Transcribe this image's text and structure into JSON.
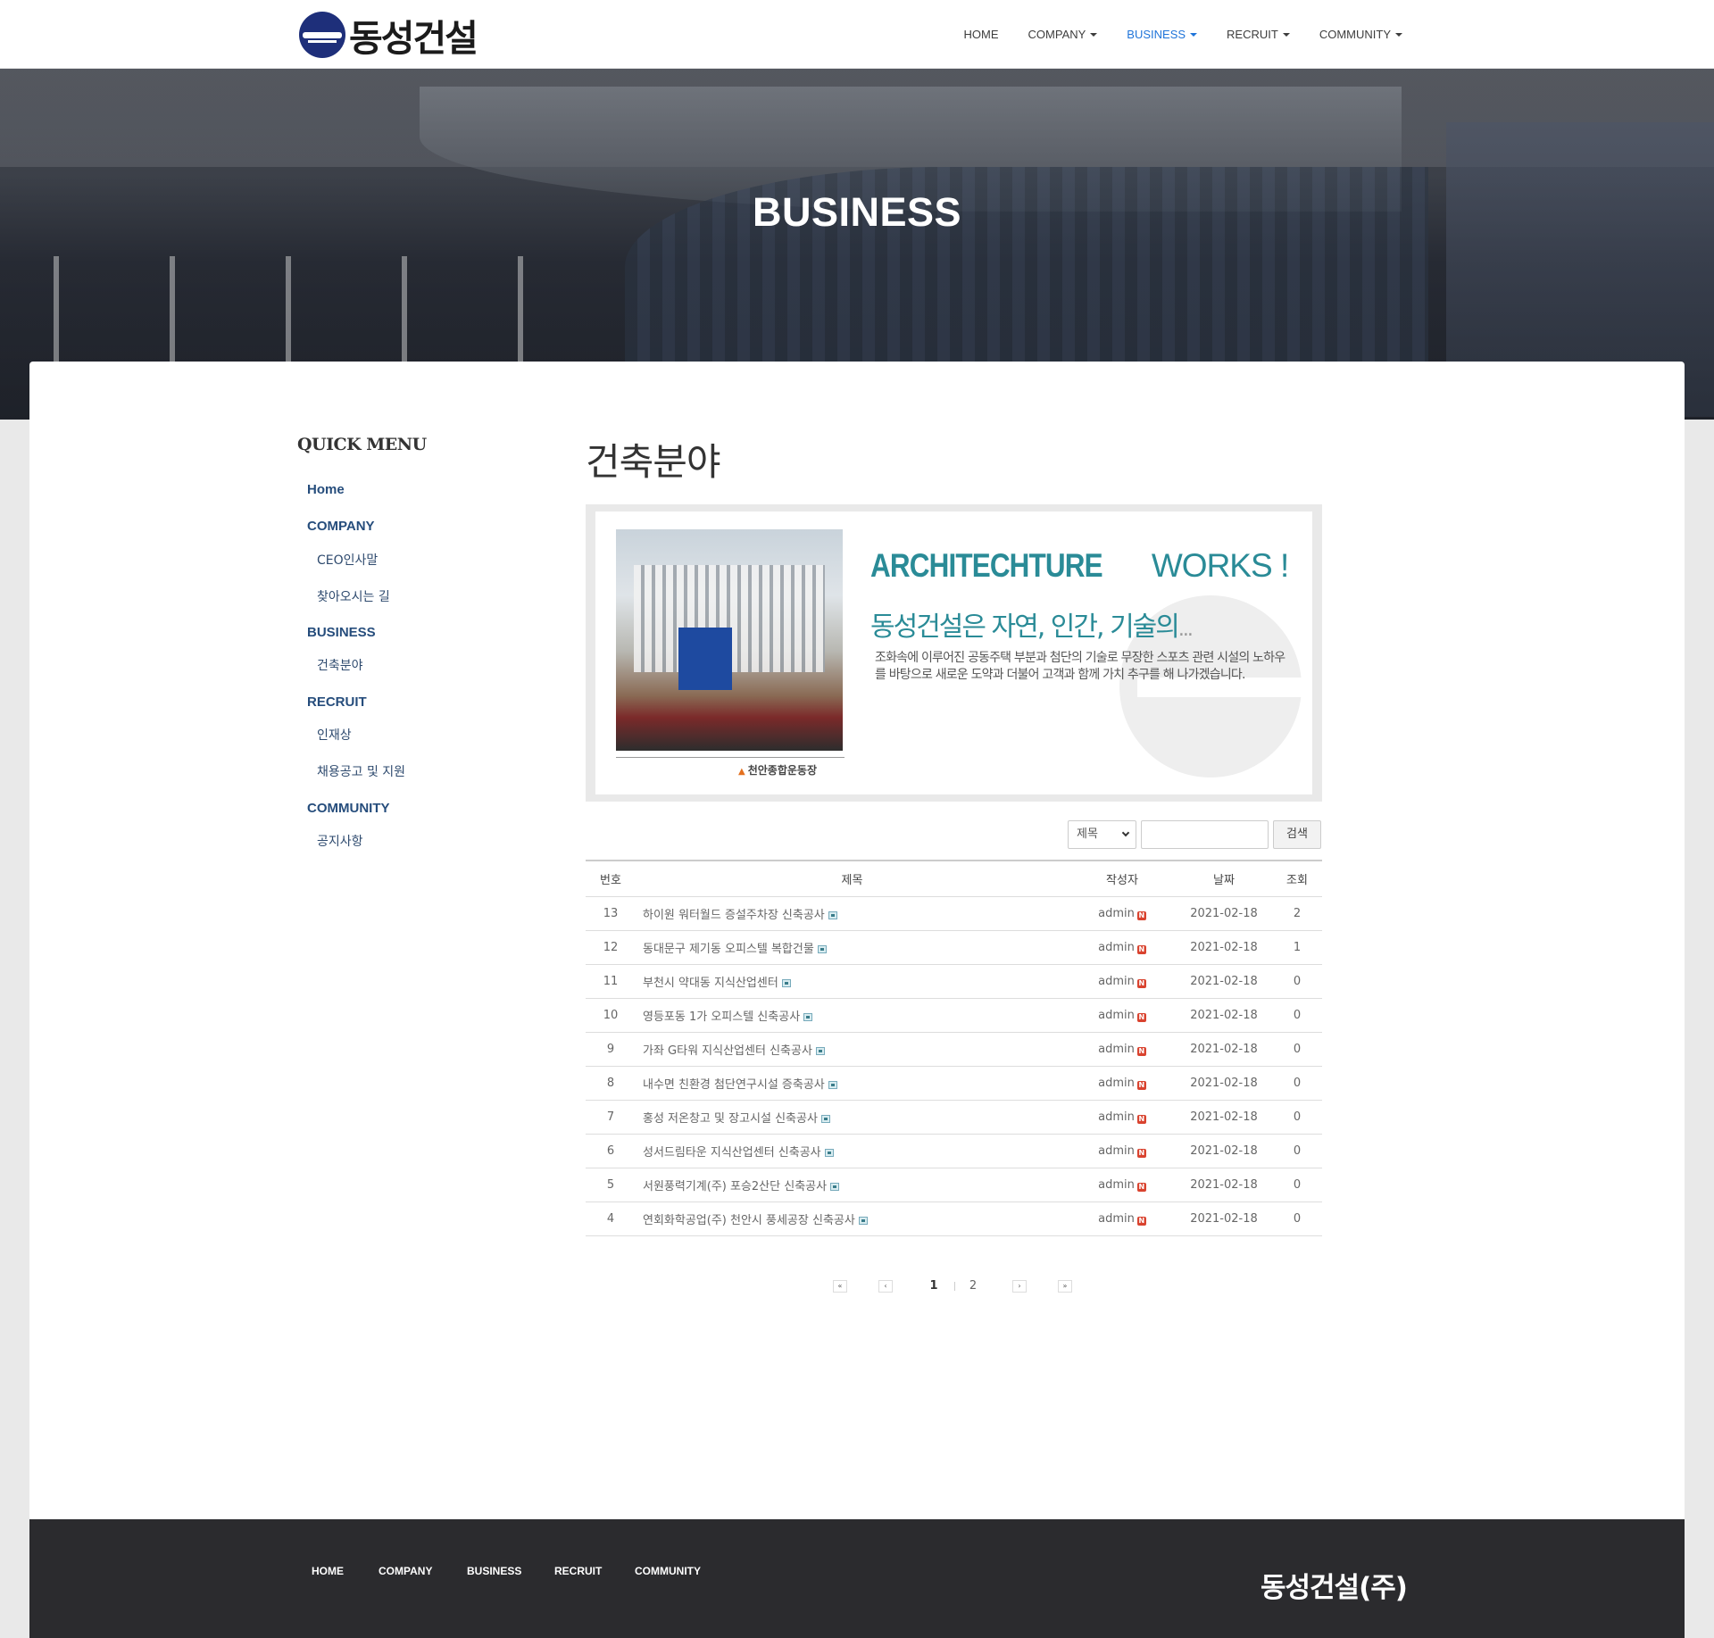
{
  "header": {
    "logo_text": "동성건설",
    "nav": [
      {
        "label": "HOME"
      },
      {
        "label": "COMPANY"
      },
      {
        "label": "BUSINESS"
      },
      {
        "label": "RECRUIT"
      },
      {
        "label": "COMMUNITY"
      }
    ],
    "active": "BUSINESS",
    "accent_color": "#1f74d9"
  },
  "hero": {
    "title": "BUSINESS"
  },
  "quick_menu": {
    "title": "QUICK MENU",
    "home": "Home",
    "company": "COMPANY",
    "company_items": [
      "CEO인사말",
      "찾아오시는 길"
    ],
    "business": "BUSINESS",
    "business_items": [
      "건축분야"
    ],
    "recruit": "RECRUIT",
    "recruit_items": [
      "인재상",
      "채용공고 및 지원"
    ],
    "community": "COMMUNITY",
    "community_items": [
      "공지사항"
    ]
  },
  "main": {
    "title": "건축분야",
    "banner": {
      "headline_a": "ARCHITECHTURE",
      "headline_b": " WORKS !",
      "subhead": "동성건설은 자연, 인간, 기술의",
      "subhead_dots": "...",
      "body": "조화속에 이루어진 공동주택 부분과 첨단의 기술로 무장한 스포츠 관련 시설의  노하우를 바탕으로 새로운 도약과 더불어 고객과 함께 가치 추구를 해 나가겠습니다.",
      "caption": "천안종합운동장"
    },
    "search": {
      "select_value": "제목",
      "input_value": "",
      "button_label": "검색"
    },
    "table": {
      "headers": [
        "번호",
        "제목",
        "작성자",
        "날짜",
        "조회"
      ],
      "rows": [
        {
          "no": "13",
          "title": "하이원 워터월드 증설주차장 신축공사",
          "author": "admin",
          "date": "2021-02-18",
          "views": "2"
        },
        {
          "no": "12",
          "title": "동대문구 제기동 오피스텔 복합건물",
          "author": "admin",
          "date": "2021-02-18",
          "views": "1"
        },
        {
          "no": "11",
          "title": "부천시 약대동 지식산업센터",
          "author": "admin",
          "date": "2021-02-18",
          "views": "0"
        },
        {
          "no": "10",
          "title": "영등포동 1가 오피스텔 신축공사",
          "author": "admin",
          "date": "2021-02-18",
          "views": "0"
        },
        {
          "no": "9",
          "title": "가좌 G타워 지식산업센터 신축공사",
          "author": "admin",
          "date": "2021-02-18",
          "views": "0"
        },
        {
          "no": "8",
          "title": "내수면 친환경 첨단연구시설 증축공사",
          "author": "admin",
          "date": "2021-02-18",
          "views": "0"
        },
        {
          "no": "7",
          "title": "홍성 저온창고 및 장고시설 신축공사",
          "author": "admin",
          "date": "2021-02-18",
          "views": "0"
        },
        {
          "no": "6",
          "title": "성서드림타운 지식산업센터 신축공사",
          "author": "admin",
          "date": "2021-02-18",
          "views": "0"
        },
        {
          "no": "5",
          "title": "서원풍력기계(주) 포승2산단 신축공사",
          "author": "admin",
          "date": "2021-02-18",
          "views": "0"
        },
        {
          "no": "4",
          "title": "연회화학공업(주) 천안시 풍세공장 신축공사",
          "author": "admin",
          "date": "2021-02-18",
          "views": "0"
        }
      ]
    },
    "pagination": {
      "first": "«",
      "prev": "‹",
      "pages": [
        "1",
        "2"
      ],
      "current": "1",
      "next": "›",
      "last": "»"
    }
  },
  "footer": {
    "links": [
      "HOME",
      "COMPANY",
      "BUSINESS",
      "RECRUIT",
      "COMMUNITY"
    ],
    "brand": "동성건설(주)"
  }
}
